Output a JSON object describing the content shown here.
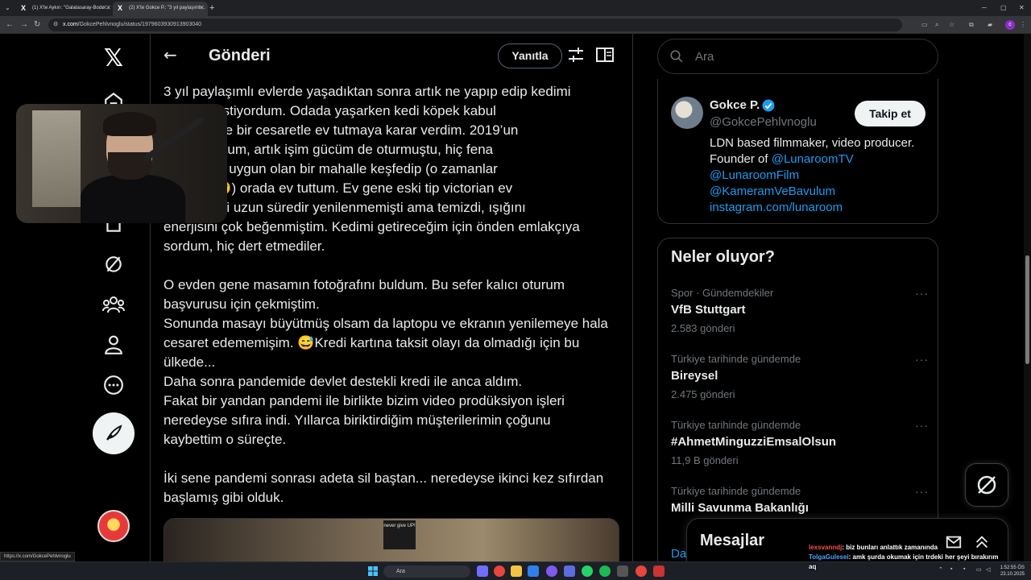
{
  "browser": {
    "tabs": [
      {
        "title": "(1) X'te Aykırı: \"Galatasaray-Bodø/...",
        "active": false
      },
      {
        "title": "(2) X'te Gokce P.: \"3 yıl paylaşımlı...",
        "active": true
      }
    ],
    "new_tab": "+",
    "url_host": "x.com",
    "url_path": "/GokcePehlvnoglu/status/1979603930913903040"
  },
  "header": {
    "title": "Gönderi",
    "reply_label": "Yanıtla"
  },
  "post": {
    "paragraphs": [
      "3 yıl paylaşımlı evlerde yaşadıktan sonra artık ne yapıp edip kedimi\n   getirmek istiyordum. Odada yaşarken kedi köpek kabul\n  Bu nedenle bir cesaretle ev tutmaya karar verdim. 2019’un\n  ğru evi tuttum, artık işim gücüm de oturmuştu, hiç fena\n  . Nispeten uygun olan bir mahalle keşfedip (o zamanlar\n  tık değil 😏) orada ev tuttum. Ev gene eski tip victorian ev\n  ürdendi, içi uzun süredir yenilenmemişti ama temizdi, ışığını\nenerjisini çok beğenmiştim. Kedimi getireceğim için önden emlakçıya\nsordum, hiç dert etmediler.",
      "O evden gene masamın fotoğrafını buldum. Bu sefer kalıcı oturum\nbaşvurusu için çekmiştim.\nSonunda masayı büyütmüş olsam da laptopu ve ekranın yenilemeye hala\ncesaret edememişim. 😅Kredi kartına taksit olayı da olmadığı için bu\nülkede...\nDaha sonra pandemide devlet destekli kredi ile anca aldım.\nFakat bir yandan pandemi ile birlikte bizim video prodüksiyon işleri\nneredeyse sıfıra indi. Yıllarca biriktirdiğim müşterilerimin çoğunu\nkaybettim o süreçte.",
      "İki sene pandemi sonrası adeta sil baştan... neredeyse ikinci kez sıfırdan\nbaşlamış gibi olduk."
    ],
    "image_sign": "never give UP!"
  },
  "search": {
    "placeholder": "Ara"
  },
  "profile": {
    "name": "Gokce P.",
    "handle": "@GokcePehlvnoglu",
    "follow_label": "Takip et",
    "bio_line1": "LDN based filmmaker, video producer.",
    "bio_line2_prefix": "Founder of ",
    "bio_link1": "@LunaroomTV",
    "bio_link2": "@LunaroomFilm",
    "bio_link3": "@KameramVeBavulum",
    "bio_link4": "instagram.com/lunaroom"
  },
  "trends": {
    "title": "Neler oluyor?",
    "items": [
      {
        "context": "Spor · Gündemdekiler",
        "name": "VfB Stuttgart",
        "count": "2.583 gönderi"
      },
      {
        "context": "Türkiye tarihinde gündemde",
        "name": "Bireysel",
        "count": "2.475 gönderi"
      },
      {
        "context": "Türkiye tarihinde gündemde",
        "name": "#AhmetMinguzziEmsalOlsun",
        "count": "11,9 B gönderi"
      },
      {
        "context": "Türkiye tarihinde gündemde",
        "name": "Milli Savunma Bakanlığı",
        "count": ""
      }
    ],
    "more_label": "···",
    "cut_text": "Da"
  },
  "messages": {
    "title": "Mesajlar"
  },
  "chat": [
    {
      "user": "lexsvanndj",
      "text": ": biz bunları anlattık zamanında"
    },
    {
      "user": "TolgaGulesei",
      "text": ": amk şurda okumak için trdeki her şeyi bırakırım"
    },
    {
      "user": "",
      "text": "aq"
    }
  ],
  "status_link": "https://x.com/GokcePehlvnoglu",
  "taskbar": {
    "search_label": "Ara",
    "time": "1:52:55 ÖS",
    "date": "23.10.2025"
  },
  "colors": {
    "accent": "#1d9bf0",
    "background": "#000000",
    "border": "#2f3336",
    "muted": "#71767b"
  }
}
